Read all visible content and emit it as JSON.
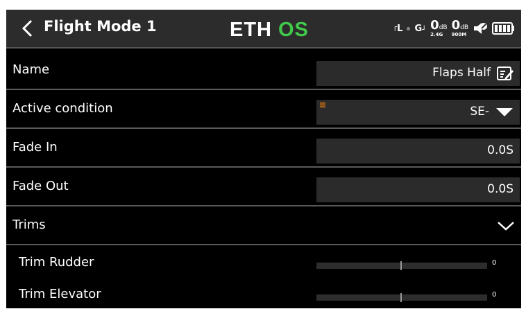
{
  "header": {
    "title": "Flight Mode 1",
    "logo_text": "ETHOS",
    "logo_colors": {
      "main": "#ffffff",
      "accent": "#41c94b"
    },
    "status": {
      "tl_label": "L",
      "g_label": "G",
      "rx1_value": "0",
      "rx1_unit": "dB",
      "rx1_band": "2.4G",
      "rx2_value": "0",
      "rx2_unit": "dB",
      "rx2_band": "900M",
      "icons": [
        "telemetry-icon",
        "gps-icon",
        "speaker-muted-icon",
        "battery-icon"
      ]
    }
  },
  "form": {
    "name": {
      "label": "Name",
      "value": "Flaps Half",
      "icon": "edit-icon"
    },
    "active_condition": {
      "label": "Active condition",
      "value": "SE-",
      "icon": "dropdown-triangle-icon"
    },
    "fade_in": {
      "label": "Fade In",
      "value": "0.0S"
    },
    "fade_out": {
      "label": "Fade Out",
      "value": "0.0S"
    },
    "trims": {
      "label": "Trims",
      "icon": "chevron-down-icon",
      "expanded": true
    }
  },
  "trims": [
    {
      "label": "Trim Rudder",
      "value": "0"
    },
    {
      "label": "Trim Elevator",
      "value": "0"
    }
  ],
  "colors": {
    "accent": "#e07a10",
    "background": "#000000",
    "field": "#2b2b2b",
    "divider": "#5a5a5a"
  }
}
